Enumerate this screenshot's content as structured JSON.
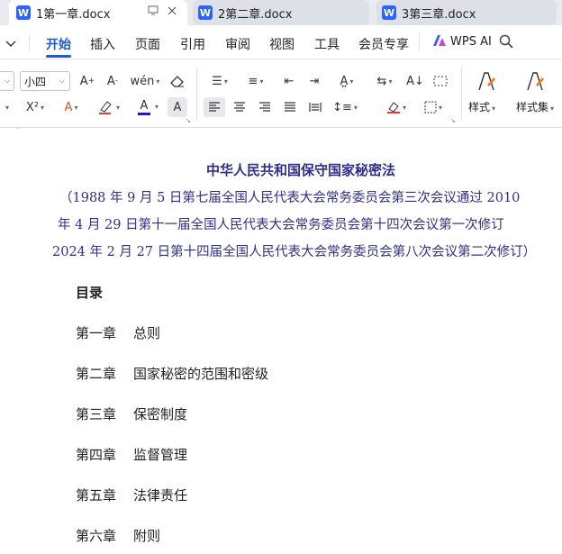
{
  "tabs": [
    {
      "label": "1第一章.docx",
      "icon": "W"
    },
    {
      "label": "2第二章.docx",
      "icon": "W"
    },
    {
      "label": "3第三章.docx",
      "icon": "W"
    }
  ],
  "menu": {
    "items": [
      "开始",
      "插入",
      "页面",
      "引用",
      "审阅",
      "视图",
      "工具",
      "会员专享"
    ],
    "active": "开始",
    "wps_ai": "WPS AI"
  },
  "ribbon": {
    "font_size": "小四",
    "styles_label": "样式",
    "style_set_label": "样式集"
  },
  "document": {
    "title": "中华人民共和国保守国家秘密法",
    "subtitle_lines": [
      "（1988 年 9 月 5 日第七届全国人民代表大会常务委员会第三次会议通过 2010",
      "年 4 月 29 日第十一届全国人民代表大会常务委员会第十四次会议第一次修订",
      "2024 年 2 月 27 日第十四届全国人民代表大会常务委员会第八次会议第二次修订）"
    ],
    "toc_heading": "目录",
    "toc": [
      {
        "num": "第一章",
        "title": "总则"
      },
      {
        "num": "第二章",
        "title": "国家秘密的范围和密级"
      },
      {
        "num": "第三章",
        "title": "保密制度"
      },
      {
        "num": "第四章",
        "title": "监督管理"
      },
      {
        "num": "第五章",
        "title": "法律责任"
      },
      {
        "num": "第六章",
        "title": "附则"
      }
    ]
  },
  "colors": {
    "accent": "#1f5bd8",
    "doc_title": "#2f2f8f",
    "word_icon": "#2b64f6"
  }
}
